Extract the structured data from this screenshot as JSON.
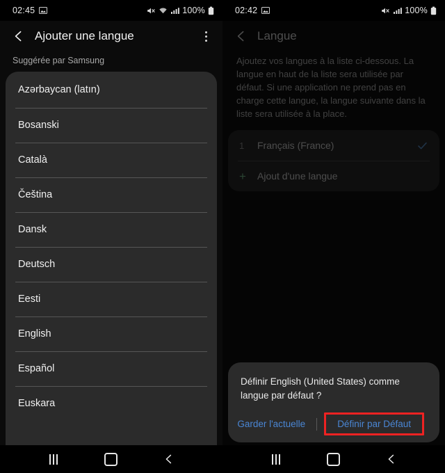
{
  "left": {
    "status": {
      "time": "02:45",
      "image_icon": "image-icon",
      "mute_icon": "mute-icon",
      "wifi_icon": "wifi-icon",
      "signal_icon": "signal-icon",
      "battery_percent": "100%",
      "battery_icon": "battery-icon"
    },
    "appbar": {
      "back_icon": "back-arrow-icon",
      "title": "Ajouter une langue",
      "overflow_icon": "more-options-icon"
    },
    "section_header": "Suggérée par Samsung",
    "languages": [
      "Azərbaycan (latın)",
      "Bosanski",
      "Català",
      "Čeština",
      "Dansk",
      "Deutsch",
      "Eesti",
      "English",
      "Español",
      "Euskara"
    ]
  },
  "right": {
    "status": {
      "time": "02:42",
      "image_icon": "image-icon",
      "mute_icon": "mute-icon",
      "signal_icon": "signal-icon",
      "battery_percent": "100%",
      "battery_icon": "battery-icon"
    },
    "appbar": {
      "back_icon": "back-arrow-icon",
      "title": "Langue"
    },
    "description": "Ajoutez vos langues à la liste ci-dessous. La langue en haut de la liste sera utilisée par défaut. Si une application ne prend pas en charge cette langue, la langue suivante dans la liste sera utilisée à la place.",
    "language_rows": [
      {
        "index": "1",
        "label": "Français (France)",
        "checked": "check-icon"
      }
    ],
    "add_language": {
      "plus_icon": "plus-icon",
      "label": "Ajout d'une langue"
    },
    "dialog": {
      "message": "Définir English (United States) comme langue par défaut ?",
      "keep_button": "Garder l'actuelle",
      "set_button": "Définir par Défaut",
      "highlight_color": "#ee2222",
      "button_color": "#4a86d4"
    }
  },
  "navbar": {
    "recents_icon": "recents-icon",
    "home_icon": "home-icon",
    "back_icon": "back-icon"
  }
}
